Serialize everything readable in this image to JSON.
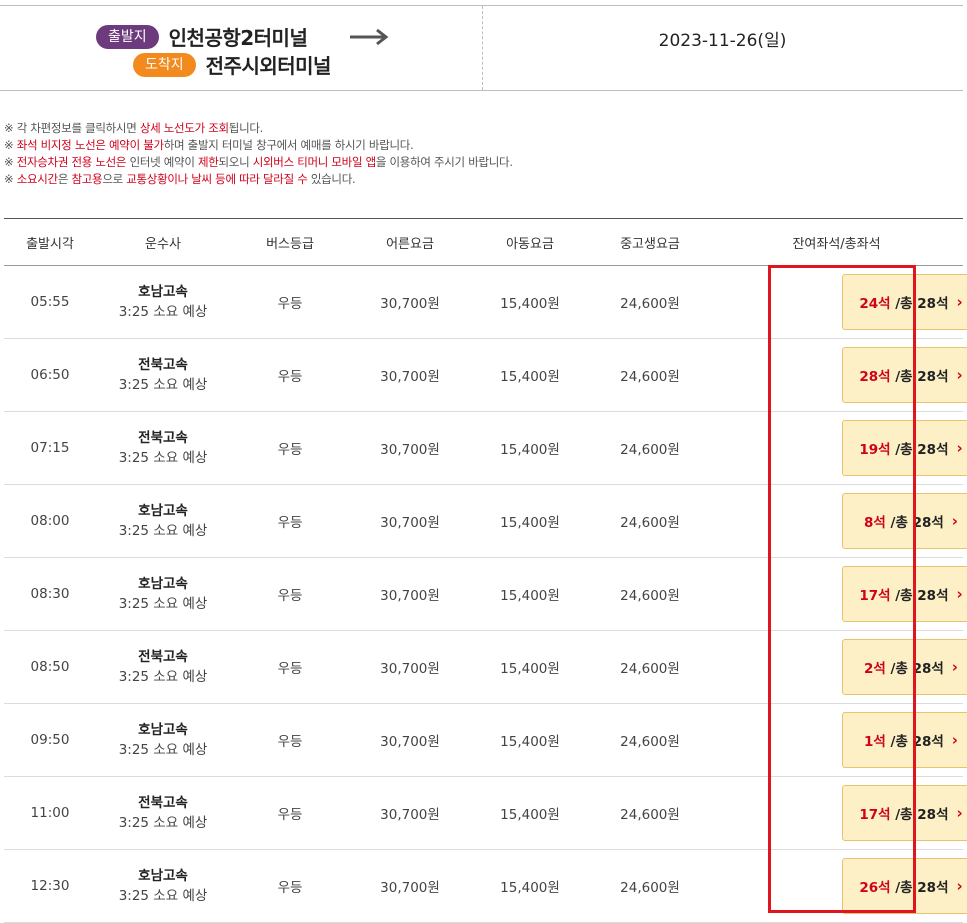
{
  "route": {
    "departure_badge": "출발지",
    "departure_terminal": "인천공항2터미널",
    "arrival_badge": "도착지",
    "arrival_terminal": "전주시외터미널",
    "date": "2023-11-26(일)"
  },
  "notes": [
    [
      {
        "t": "※ 각 차편정보를 클릭하시면 "
      },
      {
        "t": "상세 노선도가 조회",
        "red": true
      },
      {
        "t": "됩니다."
      }
    ],
    [
      {
        "t": "※ "
      },
      {
        "t": "좌석 비지정 노선은 예약이 불가",
        "red": true
      },
      {
        "t": "하며 출발지 터미널 창구에서 예매를 하시기 바랍니다."
      }
    ],
    [
      {
        "t": "※ "
      },
      {
        "t": "전자승차권 전용 노선은",
        "red": true
      },
      {
        "t": " 인터넷 예약이 "
      },
      {
        "t": "제한",
        "red": true
      },
      {
        "t": "되오니 "
      },
      {
        "t": "시외버스 티머니 모바일 앱",
        "red": true
      },
      {
        "t": "을 이용하여 주시기 바랍니다."
      }
    ],
    [
      {
        "t": "※ "
      },
      {
        "t": "소요시간",
        "red": true
      },
      {
        "t": "은 "
      },
      {
        "t": "참고용",
        "red": true
      },
      {
        "t": "으로 "
      },
      {
        "t": "교통상황이나 날씨 등에 따라 달라질 수",
        "red": true
      },
      {
        "t": " 있습니다."
      }
    ]
  ],
  "columns": [
    "출발시각",
    "운수사",
    "버스등급",
    "어른요금",
    "아동요금",
    "중고생요금",
    "잔여좌석/총좌석"
  ],
  "rows": [
    {
      "time": "05:55",
      "company": "호남고속",
      "duration": "3:25 소요 예상",
      "grade": "우등",
      "adult": "30,700원",
      "child": "15,400원",
      "teen": "24,600원",
      "remaining": "24석",
      "total": " /총 28석"
    },
    {
      "time": "06:50",
      "company": "전북고속",
      "duration": "3:25 소요 예상",
      "grade": "우등",
      "adult": "30,700원",
      "child": "15,400원",
      "teen": "24,600원",
      "remaining": "28석",
      "total": " /총 28석"
    },
    {
      "time": "07:15",
      "company": "전북고속",
      "duration": "3:25 소요 예상",
      "grade": "우등",
      "adult": "30,700원",
      "child": "15,400원",
      "teen": "24,600원",
      "remaining": "19석",
      "total": " /총 28석"
    },
    {
      "time": "08:00",
      "company": "호남고속",
      "duration": "3:25 소요 예상",
      "grade": "우등",
      "adult": "30,700원",
      "child": "15,400원",
      "teen": "24,600원",
      "remaining": "8석",
      "total": " /총 28석"
    },
    {
      "time": "08:30",
      "company": "호남고속",
      "duration": "3:25 소요 예상",
      "grade": "우등",
      "adult": "30,700원",
      "child": "15,400원",
      "teen": "24,600원",
      "remaining": "17석",
      "total": " /총 28석"
    },
    {
      "time": "08:50",
      "company": "전북고속",
      "duration": "3:25 소요 예상",
      "grade": "우등",
      "adult": "30,700원",
      "child": "15,400원",
      "teen": "24,600원",
      "remaining": "2석",
      "total": " /총 28석"
    },
    {
      "time": "09:50",
      "company": "호남고속",
      "duration": "3:25 소요 예상",
      "grade": "우등",
      "adult": "30,700원",
      "child": "15,400원",
      "teen": "24,600원",
      "remaining": "1석",
      "total": " /총 28석"
    },
    {
      "time": "11:00",
      "company": "전북고속",
      "duration": "3:25 소요 예상",
      "grade": "우등",
      "adult": "30,700원",
      "child": "15,400원",
      "teen": "24,600원",
      "remaining": "17석",
      "total": " /총 28석"
    },
    {
      "time": "12:30",
      "company": "호남고속",
      "duration": "3:25 소요 예상",
      "grade": "우등",
      "adult": "30,700원",
      "child": "15,400원",
      "teen": "24,600원",
      "remaining": "26석",
      "total": " /총 28석"
    }
  ],
  "colors": {
    "departure_badge": "#6d3a7d",
    "arrival_badge": "#f28a1e",
    "highlight": "#e0161e",
    "seat_button": "#fdf0c6",
    "emphasis": "#d0021b"
  },
  "icons": {
    "route_arrow": "right-arrow-icon",
    "seat_chevron": "chevron-right-icon"
  }
}
